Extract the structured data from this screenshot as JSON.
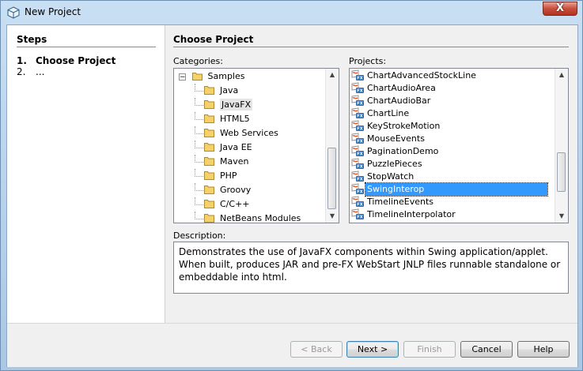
{
  "window": {
    "title": "New Project",
    "close_label": "X"
  },
  "steps": {
    "heading": "Steps",
    "items": [
      {
        "num": "1.",
        "label": "Choose Project"
      },
      {
        "num": "2.",
        "label": "..."
      }
    ]
  },
  "main": {
    "heading": "Choose Project",
    "categories_label": "Categories:",
    "projects_label": "Projects:",
    "description_label": "Description:",
    "description": "Demonstrates the use of JavaFX components within Swing application/applet. When built, produces JAR and pre-FX WebStart JNLP files runnable standalone or embeddable into html."
  },
  "categories": {
    "root": "Samples",
    "root_toggle": "−",
    "items": [
      "Java",
      "JavaFX",
      "HTML5",
      "Web Services",
      "Java EE",
      "Maven",
      "PHP",
      "Groovy",
      "C/C++",
      "NetBeans Modules"
    ],
    "selected": "JavaFX"
  },
  "projects": {
    "items": [
      "ChartAdvancedStockLine",
      "ChartAudioArea",
      "ChartAudioBar",
      "ChartLine",
      "KeyStrokeMotion",
      "MouseEvents",
      "PaginationDemo",
      "PuzzlePieces",
      "StopWatch",
      "SwingInterop",
      "TimelineEvents",
      "TimelineInterpolator"
    ],
    "selected": "SwingInterop",
    "icon_label": "FX"
  },
  "buttons": {
    "back": "< Back",
    "next": "Next >",
    "finish": "Finish",
    "cancel": "Cancel",
    "help": "Help"
  },
  "scroll": {
    "up": "▲",
    "down": "▼"
  }
}
